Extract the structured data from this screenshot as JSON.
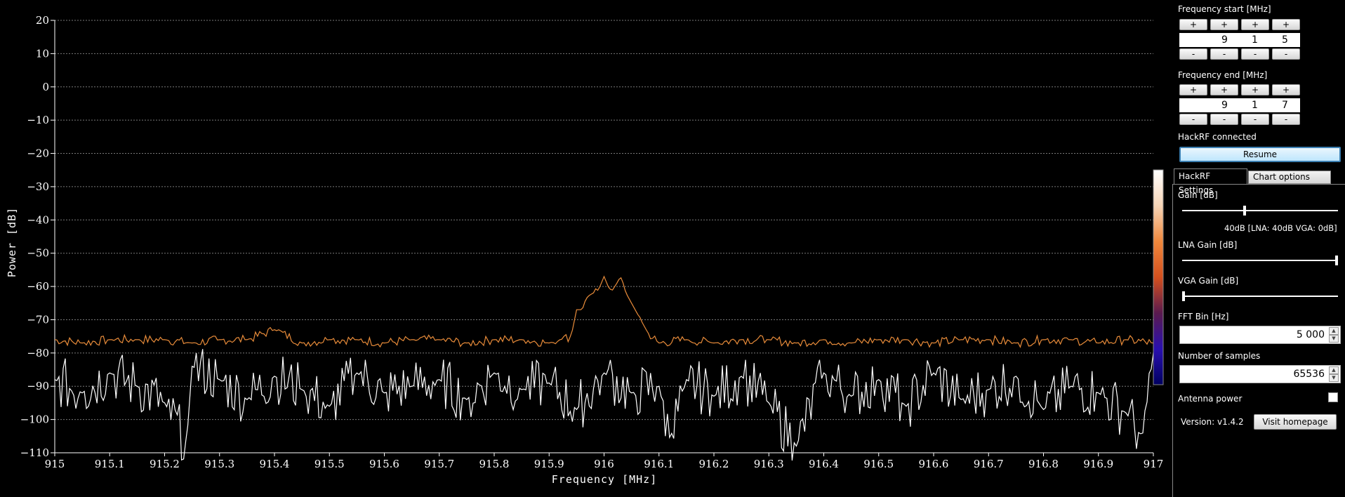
{
  "chart_data": {
    "type": "line",
    "title": "",
    "xlabel": "Frequency [MHz]",
    "ylabel": "Power [dB]",
    "xlim": [
      915,
      917
    ],
    "ylim": [
      -110,
      20
    ],
    "grid": true,
    "x_ticks": [
      "915",
      "915.1",
      "915.2",
      "915.3",
      "915.4",
      "915.5",
      "915.6",
      "915.7",
      "915.8",
      "915.9",
      "916",
      "916.1",
      "916.2",
      "916.3",
      "916.4",
      "916.5",
      "916.6",
      "916.7",
      "916.8",
      "916.9",
      "917"
    ],
    "y_ticks": [
      "20",
      "10",
      "0",
      "−10",
      "−20",
      "−30",
      "−40",
      "−50",
      "−60",
      "−70",
      "−80",
      "−90",
      "−100",
      "−110"
    ],
    "colors": {
      "peak_hold": "#e98c3a",
      "live": "#ffffff",
      "grid": "#7a7a7a"
    },
    "colorbar": {
      "stops": [
        "#ffffff",
        "#f7d6b8",
        "#f0883c",
        "#d4501e",
        "#5a1a4e",
        "#2a10b0",
        "#000060"
      ]
    },
    "series": [
      {
        "x": [
          915.0,
          915.05,
          915.1,
          915.15,
          915.2,
          915.25,
          915.3,
          915.35,
          915.4,
          915.45,
          915.5,
          915.55,
          915.6,
          915.65,
          915.7,
          915.75,
          915.8,
          915.85,
          915.9,
          915.92,
          915.94,
          915.95,
          915.96,
          915.97,
          915.98,
          915.99,
          916.0,
          916.01,
          916.02,
          916.03,
          916.04,
          916.05,
          916.06,
          916.07,
          916.08,
          916.1,
          916.15,
          916.2,
          916.25,
          916.3,
          916.35,
          916.4,
          916.45,
          916.5,
          916.55,
          916.6,
          916.65,
          916.7,
          916.75,
          916.8,
          916.85,
          916.9,
          916.95,
          917.0
        ],
        "values": [
          -76,
          -77,
          -76,
          -76,
          -76,
          -77,
          -76,
          -76,
          -73,
          -77,
          -76,
          -76,
          -77,
          -76,
          -76,
          -77,
          -76,
          -76,
          -77,
          -76,
          -75,
          -67,
          -67,
          -63,
          -62,
          -61,
          -57,
          -61,
          -60,
          -57,
          -62,
          -65,
          -68,
          -71,
          -74,
          -77,
          -76,
          -77,
          -76,
          -76,
          -77,
          -76,
          -77,
          -76,
          -76,
          -77,
          -76,
          -76,
          -77,
          -76,
          -76,
          -77,
          -76,
          -77
        ]
      },
      {
        "x": [
          915.0,
          915.05,
          915.1,
          915.15,
          915.2,
          915.24,
          915.25,
          915.3,
          915.35,
          915.4,
          915.45,
          915.5,
          915.55,
          915.6,
          915.65,
          915.7,
          915.75,
          915.8,
          915.85,
          915.9,
          915.95,
          916.0,
          916.05,
          916.1,
          916.12,
          916.15,
          916.2,
          916.25,
          916.3,
          916.35,
          916.4,
          916.45,
          916.5,
          916.55,
          916.6,
          916.65,
          916.7,
          916.75,
          916.8,
          916.85,
          916.9,
          916.95,
          916.98,
          917.0
        ],
        "values": [
          -88,
          -92,
          -86,
          -90,
          -95,
          -107,
          -84,
          -88,
          -94,
          -87,
          -91,
          -96,
          -86,
          -92,
          -90,
          -88,
          -94,
          -86,
          -91,
          -89,
          -97,
          -86,
          -92,
          -90,
          -106,
          -88,
          -93,
          -87,
          -95,
          -108,
          -86,
          -93,
          -88,
          -96,
          -86,
          -94,
          -91,
          -87,
          -97,
          -90,
          -92,
          -98,
          -105,
          -80
        ]
      }
    ]
  },
  "panel": {
    "freq_start_label": "Frequency start [MHz]",
    "freq_start_digits": [
      "",
      "9",
      "1",
      "5"
    ],
    "freq_end_label": "Frequency end [MHz]",
    "freq_end_digits": [
      "",
      "9",
      "1",
      "7"
    ],
    "plus": "+",
    "minus": "-",
    "status": "HackRF connected",
    "resume_label": "Resume",
    "tab_hackrf": "HackRF Settings",
    "tab_chart": "Chart options",
    "gain_label": "Gain [dB]",
    "gain_readout": "40dB  [LNA: 40dB  VGA: 0dB]",
    "gain_level": 0.4,
    "lna_label": "LNA Gain [dB]",
    "lna_level": 1.0,
    "vga_label": "VGA Gain [dB]",
    "vga_level": 0.0,
    "fft_label": "FFT Bin [Hz]",
    "fft_value": "5 000",
    "samples_label": "Number of samples",
    "samples_value": "65536",
    "antenna_label": "Antenna power",
    "version": "Version: v1.4.2",
    "visit_label": "Visit homepage"
  }
}
